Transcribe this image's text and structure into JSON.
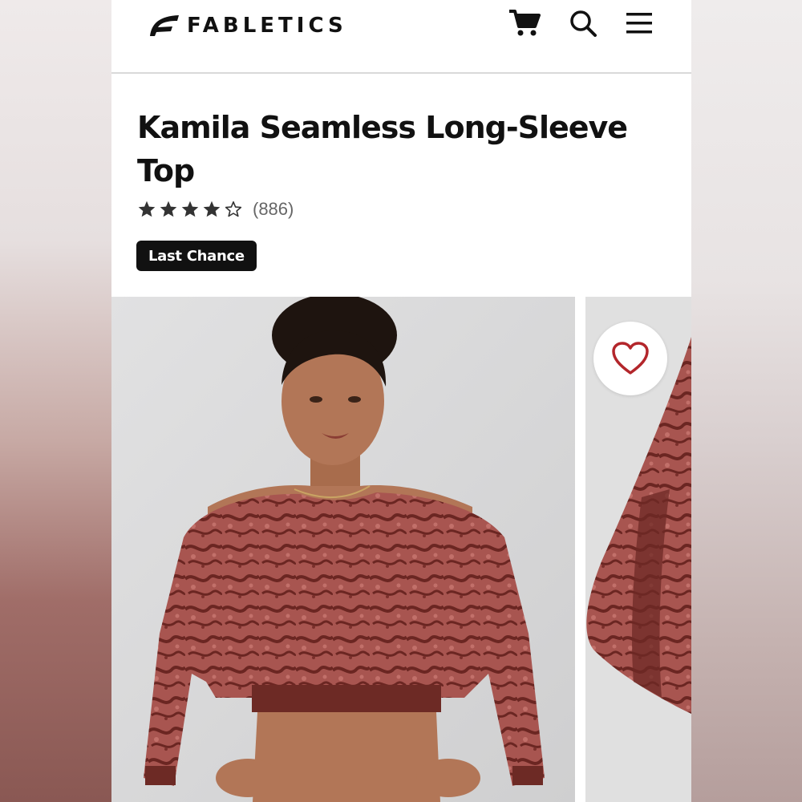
{
  "header": {
    "brand": "FABLETICS",
    "icons": [
      "cart-icon",
      "search-icon",
      "menu-icon"
    ]
  },
  "product": {
    "title": "Kamila Seamless Long-Sleeve Top",
    "rating": 4,
    "rating_max": 5,
    "review_count": "(886)",
    "badge": "Last Chance"
  },
  "gallery": {
    "favorite_icon": "heart-icon"
  },
  "colors": {
    "accent": "#b3262b",
    "text": "#111111",
    "garment": "#9a4a46"
  }
}
